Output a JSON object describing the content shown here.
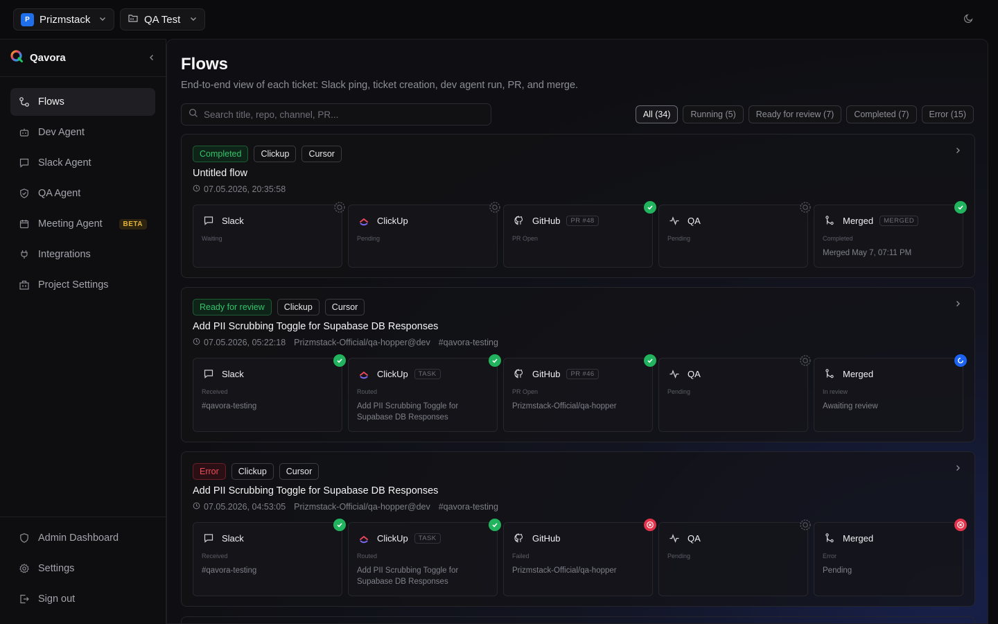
{
  "topbar": {
    "org": {
      "badge": "P",
      "name": "Prizmstack"
    },
    "project": {
      "name": "QA Test"
    },
    "theme_icon": "moon-icon"
  },
  "sidebar": {
    "brand": "Qavora",
    "items": [
      {
        "label": "Flows",
        "icon": "flow-icon",
        "active": true
      },
      {
        "label": "Dev Agent",
        "icon": "robot-icon"
      },
      {
        "label": "Slack Agent",
        "icon": "chat-icon"
      },
      {
        "label": "QA Agent",
        "icon": "shield-check-icon"
      },
      {
        "label": "Meeting Agent",
        "icon": "calendar-icon",
        "badge": "BETA"
      },
      {
        "label": "Integrations",
        "icon": "plug-icon"
      },
      {
        "label": "Project Settings",
        "icon": "building-icon"
      }
    ],
    "bottom_items": [
      {
        "label": "Admin Dashboard",
        "icon": "shield-icon"
      },
      {
        "label": "Settings",
        "icon": "gear-icon"
      },
      {
        "label": "Sign out",
        "icon": "logout-icon"
      }
    ]
  },
  "main": {
    "title": "Flows",
    "subtitle": "End-to-end view of each ticket: Slack ping, ticket creation, dev agent run, PR, and merge.",
    "search_placeholder": "Search title, repo, channel, PR...",
    "filters": [
      "All (34)",
      "Running (5)",
      "Ready for review (7)",
      "Completed (7)",
      "Error (15)"
    ]
  },
  "flows": [
    {
      "status": "Completed",
      "tags": [
        "Clickup",
        "Cursor"
      ],
      "title": "Untitled flow",
      "timestamp": "07.05.2026, 20:35:58",
      "repo": "",
      "channel": "",
      "steps": [
        {
          "name": "Slack",
          "chip": "",
          "status": "Waiting",
          "detail": "",
          "state": "pending"
        },
        {
          "name": "ClickUp",
          "chip": "",
          "status": "Pending",
          "detail": "",
          "state": "pending"
        },
        {
          "name": "GitHub",
          "chip": "PR #48",
          "status": "PR Open",
          "detail": "",
          "state": "ok"
        },
        {
          "name": "QA",
          "chip": "",
          "status": "Pending",
          "detail": "",
          "state": "pending"
        },
        {
          "name": "Merged",
          "chip": "MERGED",
          "status": "Completed",
          "detail": "Merged May 7, 07:11 PM",
          "state": "ok"
        }
      ]
    },
    {
      "status": "Ready for review",
      "tags": [
        "Clickup",
        "Cursor"
      ],
      "title": "Add PII Scrubbing Toggle for Supabase DB Responses",
      "timestamp": "07.05.2026, 05:22:18",
      "repo": "Prizmstack-Official/qa-hopper@dev",
      "channel": "#qavora-testing",
      "steps": [
        {
          "name": "Slack",
          "chip": "",
          "status": "Received",
          "detail": "#qavora-testing",
          "state": "ok"
        },
        {
          "name": "ClickUp",
          "chip": "TASK",
          "status": "Routed",
          "detail": "Add PII Scrubbing Toggle for Supabase DB Responses",
          "state": "ok"
        },
        {
          "name": "GitHub",
          "chip": "PR #46",
          "status": "PR Open",
          "detail": "Prizmstack-Official/qa-hopper",
          "state": "ok"
        },
        {
          "name": "QA",
          "chip": "",
          "status": "Pending",
          "detail": "",
          "state": "pending"
        },
        {
          "name": "Merged",
          "chip": "",
          "status": "In review",
          "detail": "Awaiting review",
          "state": "running"
        }
      ]
    },
    {
      "status": "Error",
      "tags": [
        "Clickup",
        "Cursor"
      ],
      "title": "Add PII Scrubbing Toggle for Supabase DB Responses",
      "timestamp": "07.05.2026, 04:53:05",
      "repo": "Prizmstack-Official/qa-hopper@dev",
      "channel": "#qavora-testing",
      "steps": [
        {
          "name": "Slack",
          "chip": "",
          "status": "Received",
          "detail": "#qavora-testing",
          "state": "ok"
        },
        {
          "name": "ClickUp",
          "chip": "TASK",
          "status": "Routed",
          "detail": "Add PII Scrubbing Toggle for Supabase DB Responses",
          "state": "ok"
        },
        {
          "name": "GitHub",
          "chip": "",
          "status": "Failed",
          "detail": "Prizmstack-Official/qa-hopper",
          "state": "error"
        },
        {
          "name": "QA",
          "chip": "",
          "status": "Pending",
          "detail": "",
          "state": "pending"
        },
        {
          "name": "Merged",
          "chip": "",
          "status": "Error",
          "detail": "Pending",
          "state": "error"
        }
      ]
    }
  ],
  "colors": {
    "accent_blue": "#1f6feb",
    "ok": "#22b35e",
    "error": "#e5334b",
    "running": "#1d63f2"
  }
}
